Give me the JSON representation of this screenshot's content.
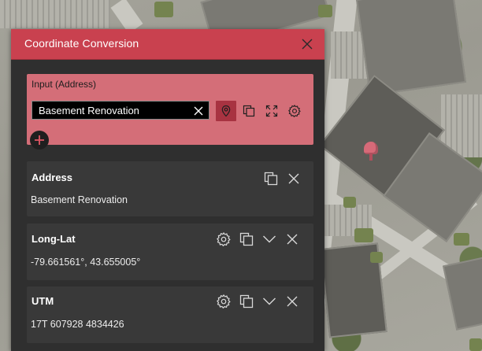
{
  "panel": {
    "title": "Coordinate Conversion",
    "accent_color": "#c9414f"
  },
  "input": {
    "label": "Input (Address)",
    "value": "Basement Renovation",
    "tool_icons": [
      "map-pin-icon",
      "copy-icon",
      "expand-icon",
      "gear-icon"
    ]
  },
  "outputs": [
    {
      "title": "Address",
      "value": "Basement Renovation",
      "icons": [
        "copy-icon",
        "close-icon"
      ]
    },
    {
      "title": "Long-Lat",
      "value": "-79.661561°, 43.655005°",
      "icons": [
        "gear-icon",
        "copy-icon",
        "chevron-down-icon",
        "close-icon"
      ]
    },
    {
      "title": "UTM",
      "value": "17T 607928 4834426",
      "icons": [
        "gear-icon",
        "copy-icon",
        "chevron-down-icon",
        "close-icon"
      ]
    }
  ]
}
